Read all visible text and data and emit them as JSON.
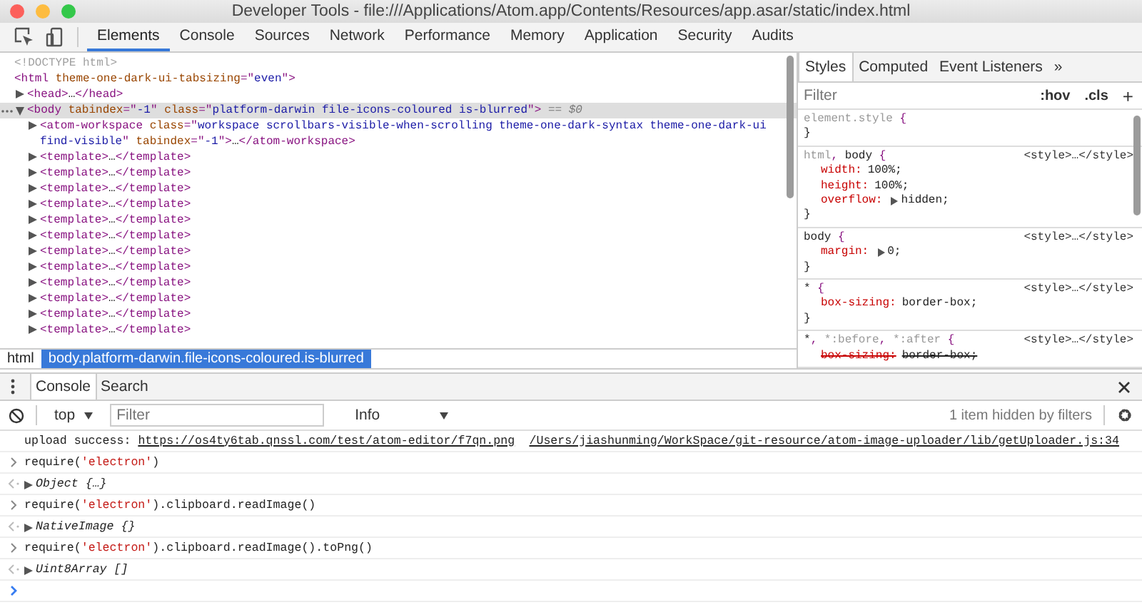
{
  "window": {
    "title": "Developer Tools - file:///Applications/Atom.app/Contents/Resources/app.asar/static/index.html"
  },
  "tabs": [
    {
      "label": "Elements",
      "selected": true
    },
    {
      "label": "Console",
      "selected": false
    },
    {
      "label": "Sources",
      "selected": false
    },
    {
      "label": "Network",
      "selected": false
    },
    {
      "label": "Performance",
      "selected": false
    },
    {
      "label": "Memory",
      "selected": false
    },
    {
      "label": "Application",
      "selected": false
    },
    {
      "label": "Security",
      "selected": false
    },
    {
      "label": "Audits",
      "selected": false
    }
  ],
  "dom": {
    "nodes": [
      {
        "selected": false,
        "segments": [
          {
            "kind": "dim",
            "text": "<!DOCTYPE html>"
          }
        ]
      },
      {
        "selected": false,
        "segments": [
          {
            "kind": "tag",
            "text": "<html"
          },
          {
            "kind": "attr",
            "text": " theme-one-dark-ui-tabsizing"
          },
          {
            "kind": "punct",
            "text": "=\""
          },
          {
            "kind": "value",
            "text": "even"
          },
          {
            "kind": "punct",
            "text": "\""
          },
          {
            "kind": "tag",
            "text": ">"
          }
        ],
        "children": [
          {
            "expanded": false,
            "selected": false,
            "segments": [
              {
                "kind": "tag",
                "text": "<head>"
              },
              {
                "kind": "text",
                "text": "…"
              },
              {
                "kind": "tag",
                "text": "</head>"
              }
            ]
          },
          {
            "expanded": true,
            "selected": true,
            "segments": [
              {
                "kind": "tag",
                "text": "<body"
              },
              {
                "kind": "attr",
                "text": " tabindex"
              },
              {
                "kind": "punct",
                "text": "=\""
              },
              {
                "kind": "value",
                "text": "-1"
              },
              {
                "kind": "punct",
                "text": "\""
              },
              {
                "kind": "attr",
                "text": " class"
              },
              {
                "kind": "punct",
                "text": "=\""
              },
              {
                "kind": "value",
                "text": "platform-darwin file-icons-coloured is-blurred"
              },
              {
                "kind": "punct",
                "text": "\""
              },
              {
                "kind": "tag",
                "text": ">"
              },
              {
                "kind": "marker",
                "text": " == $0"
              }
            ],
            "children": [
              {
                "expanded": false,
                "selected": false,
                "segments": [
                  {
                    "kind": "tag",
                    "text": "<atom-workspace"
                  },
                  {
                    "kind": "attr",
                    "text": " class"
                  },
                  {
                    "kind": "punct",
                    "text": "=\""
                  },
                  {
                    "kind": "value",
                    "text": "workspace scrollbars-visible-when-scrolling theme-one-dark-syntax theme-one-dark-ui find-visible"
                  },
                  {
                    "kind": "punct",
                    "text": "\""
                  },
                  {
                    "kind": "attr",
                    "text": " tabindex"
                  },
                  {
                    "kind": "punct",
                    "text": "=\""
                  },
                  {
                    "kind": "value",
                    "text": "-1"
                  },
                  {
                    "kind": "punct",
                    "text": "\""
                  },
                  {
                    "kind": "tag",
                    "text": ">"
                  },
                  {
                    "kind": "text",
                    "text": "…"
                  },
                  {
                    "kind": "tag",
                    "text": "</atom-workspace>"
                  }
                ]
              },
              {
                "expanded": false,
                "selected": false,
                "segments": [
                  {
                    "kind": "tag",
                    "text": "<template>"
                  },
                  {
                    "kind": "text",
                    "text": "…"
                  },
                  {
                    "kind": "tag",
                    "text": "</template>"
                  }
                ]
              },
              {
                "expanded": false,
                "selected": false,
                "segments": [
                  {
                    "kind": "tag",
                    "text": "<template>"
                  },
                  {
                    "kind": "text",
                    "text": "…"
                  },
                  {
                    "kind": "tag",
                    "text": "</template>"
                  }
                ]
              },
              {
                "expanded": false,
                "selected": false,
                "segments": [
                  {
                    "kind": "tag",
                    "text": "<template>"
                  },
                  {
                    "kind": "text",
                    "text": "…"
                  },
                  {
                    "kind": "tag",
                    "text": "</template>"
                  }
                ]
              },
              {
                "expanded": false,
                "selected": false,
                "segments": [
                  {
                    "kind": "tag",
                    "text": "<template>"
                  },
                  {
                    "kind": "text",
                    "text": "…"
                  },
                  {
                    "kind": "tag",
                    "text": "</template>"
                  }
                ]
              },
              {
                "expanded": false,
                "selected": false,
                "segments": [
                  {
                    "kind": "tag",
                    "text": "<template>"
                  },
                  {
                    "kind": "text",
                    "text": "…"
                  },
                  {
                    "kind": "tag",
                    "text": "</template>"
                  }
                ]
              },
              {
                "expanded": false,
                "selected": false,
                "segments": [
                  {
                    "kind": "tag",
                    "text": "<template>"
                  },
                  {
                    "kind": "text",
                    "text": "…"
                  },
                  {
                    "kind": "tag",
                    "text": "</template>"
                  }
                ]
              },
              {
                "expanded": false,
                "selected": false,
                "segments": [
                  {
                    "kind": "tag",
                    "text": "<template>"
                  },
                  {
                    "kind": "text",
                    "text": "…"
                  },
                  {
                    "kind": "tag",
                    "text": "</template>"
                  }
                ]
              },
              {
                "expanded": false,
                "selected": false,
                "segments": [
                  {
                    "kind": "tag",
                    "text": "<template>"
                  },
                  {
                    "kind": "text",
                    "text": "…"
                  },
                  {
                    "kind": "tag",
                    "text": "</template>"
                  }
                ]
              },
              {
                "expanded": false,
                "selected": false,
                "segments": [
                  {
                    "kind": "tag",
                    "text": "<template>"
                  },
                  {
                    "kind": "text",
                    "text": "…"
                  },
                  {
                    "kind": "tag",
                    "text": "</template>"
                  }
                ]
              },
              {
                "expanded": false,
                "selected": false,
                "segments": [
                  {
                    "kind": "tag",
                    "text": "<template>"
                  },
                  {
                    "kind": "text",
                    "text": "…"
                  },
                  {
                    "kind": "tag",
                    "text": "</template>"
                  }
                ]
              },
              {
                "expanded": false,
                "selected": false,
                "segments": [
                  {
                    "kind": "tag",
                    "text": "<template>"
                  },
                  {
                    "kind": "text",
                    "text": "…"
                  },
                  {
                    "kind": "tag",
                    "text": "</template>"
                  }
                ]
              },
              {
                "expanded": false,
                "selected": false,
                "segments": [
                  {
                    "kind": "tag",
                    "text": "<template>"
                  },
                  {
                    "kind": "text",
                    "text": "…"
                  },
                  {
                    "kind": "tag",
                    "text": "</template>"
                  }
                ]
              }
            ]
          }
        ]
      }
    ]
  },
  "breadcrumbs": [
    {
      "label": "html",
      "selected": false
    },
    {
      "label": "body.platform-darwin.file-icons-coloured.is-blurred",
      "selected": true
    }
  ],
  "styles_tabs": [
    {
      "label": "Styles",
      "selected": true
    },
    {
      "label": "Computed",
      "selected": false
    },
    {
      "label": "Event Listeners",
      "selected": false
    }
  ],
  "styles_more": "»",
  "styles_filter": {
    "placeholder": "Filter",
    "hov": ":hov",
    "cls": ".cls",
    "add": "+"
  },
  "rules": [
    {
      "selector": [
        {
          "kind": "nomatch",
          "text": "element.style"
        },
        {
          "kind": "punct",
          "text": " {"
        }
      ],
      "close": "}"
    },
    {
      "selector": [
        {
          "kind": "nomatch",
          "text": "html"
        },
        {
          "kind": "punct",
          "text": ", "
        },
        {
          "kind": "match",
          "text": "body"
        },
        {
          "kind": "punct",
          "text": " {"
        }
      ],
      "source": "<style>…</style>",
      "close": "}",
      "declarations": [
        {
          "prop": "width:",
          "value": "100%;",
          "overridden": false
        },
        {
          "prop": "height:",
          "value": "100%;",
          "overridden": false
        },
        {
          "prop": "overflow:",
          "value": "hidden;",
          "expandable": true,
          "overridden": false
        }
      ]
    },
    {
      "selector": [
        {
          "kind": "match",
          "text": "body"
        },
        {
          "kind": "punct",
          "text": " {"
        }
      ],
      "source": "<style>…</style>",
      "close": "}",
      "declarations": [
        {
          "prop": "margin:",
          "value": "0;",
          "expandable": true,
          "overridden": false
        }
      ]
    },
    {
      "selector": [
        {
          "kind": "match",
          "text": "*"
        },
        {
          "kind": "punct",
          "text": " {"
        }
      ],
      "source": "<style>…</style>",
      "close": "}",
      "declarations": [
        {
          "prop": "box-sizing:",
          "value": "border-box;",
          "overridden": false
        }
      ]
    },
    {
      "selector": [
        {
          "kind": "match",
          "text": "*"
        },
        {
          "kind": "punct",
          "text": ", "
        },
        {
          "kind": "nomatch",
          "text": "*:before"
        },
        {
          "kind": "punct",
          "text": ", "
        },
        {
          "kind": "nomatch",
          "text": "*:after"
        },
        {
          "kind": "punct",
          "text": " {"
        }
      ],
      "source": "<style>…</style>",
      "declarations": [
        {
          "prop": "box-sizing:",
          "value": "border-box;",
          "overridden": true
        }
      ]
    }
  ],
  "drawer_tabs": [
    {
      "label": "Console",
      "selected": true
    },
    {
      "label": "Search",
      "selected": false
    }
  ],
  "console_toolbar": {
    "context": "top",
    "filter_placeholder": "Filter",
    "level": "Info",
    "hidden_count": "1 item hidden by filters"
  },
  "messages": [
    {
      "kind": "log",
      "text": "upload success:",
      "link": "https://os4ty6tab.qnssl.com/test/atom-editor/f7qn.png",
      "source": "/Users/jiashunming/WorkSpace/git-resource/atom-image-uploader/lib/getUploader.js:34"
    },
    {
      "kind": "input",
      "segments": [
        {
          "kind": "code",
          "text": "require("
        },
        {
          "kind": "string",
          "text": "'electron'"
        },
        {
          "kind": "code",
          "text": ")"
        }
      ]
    },
    {
      "kind": "result",
      "text": "Object {…}"
    },
    {
      "kind": "input",
      "segments": [
        {
          "kind": "code",
          "text": "require("
        },
        {
          "kind": "string",
          "text": "'electron'"
        },
        {
          "kind": "code",
          "text": ").clipboard.readImage()"
        }
      ]
    },
    {
      "kind": "result",
      "text": "NativeImage {}"
    },
    {
      "kind": "input",
      "segments": [
        {
          "kind": "code",
          "text": "require("
        },
        {
          "kind": "string",
          "text": "'electron'"
        },
        {
          "kind": "code",
          "text": ").clipboard.readImage().toPng()"
        }
      ]
    },
    {
      "kind": "result",
      "text": "Uint8Array []"
    },
    {
      "kind": "prompt"
    }
  ]
}
